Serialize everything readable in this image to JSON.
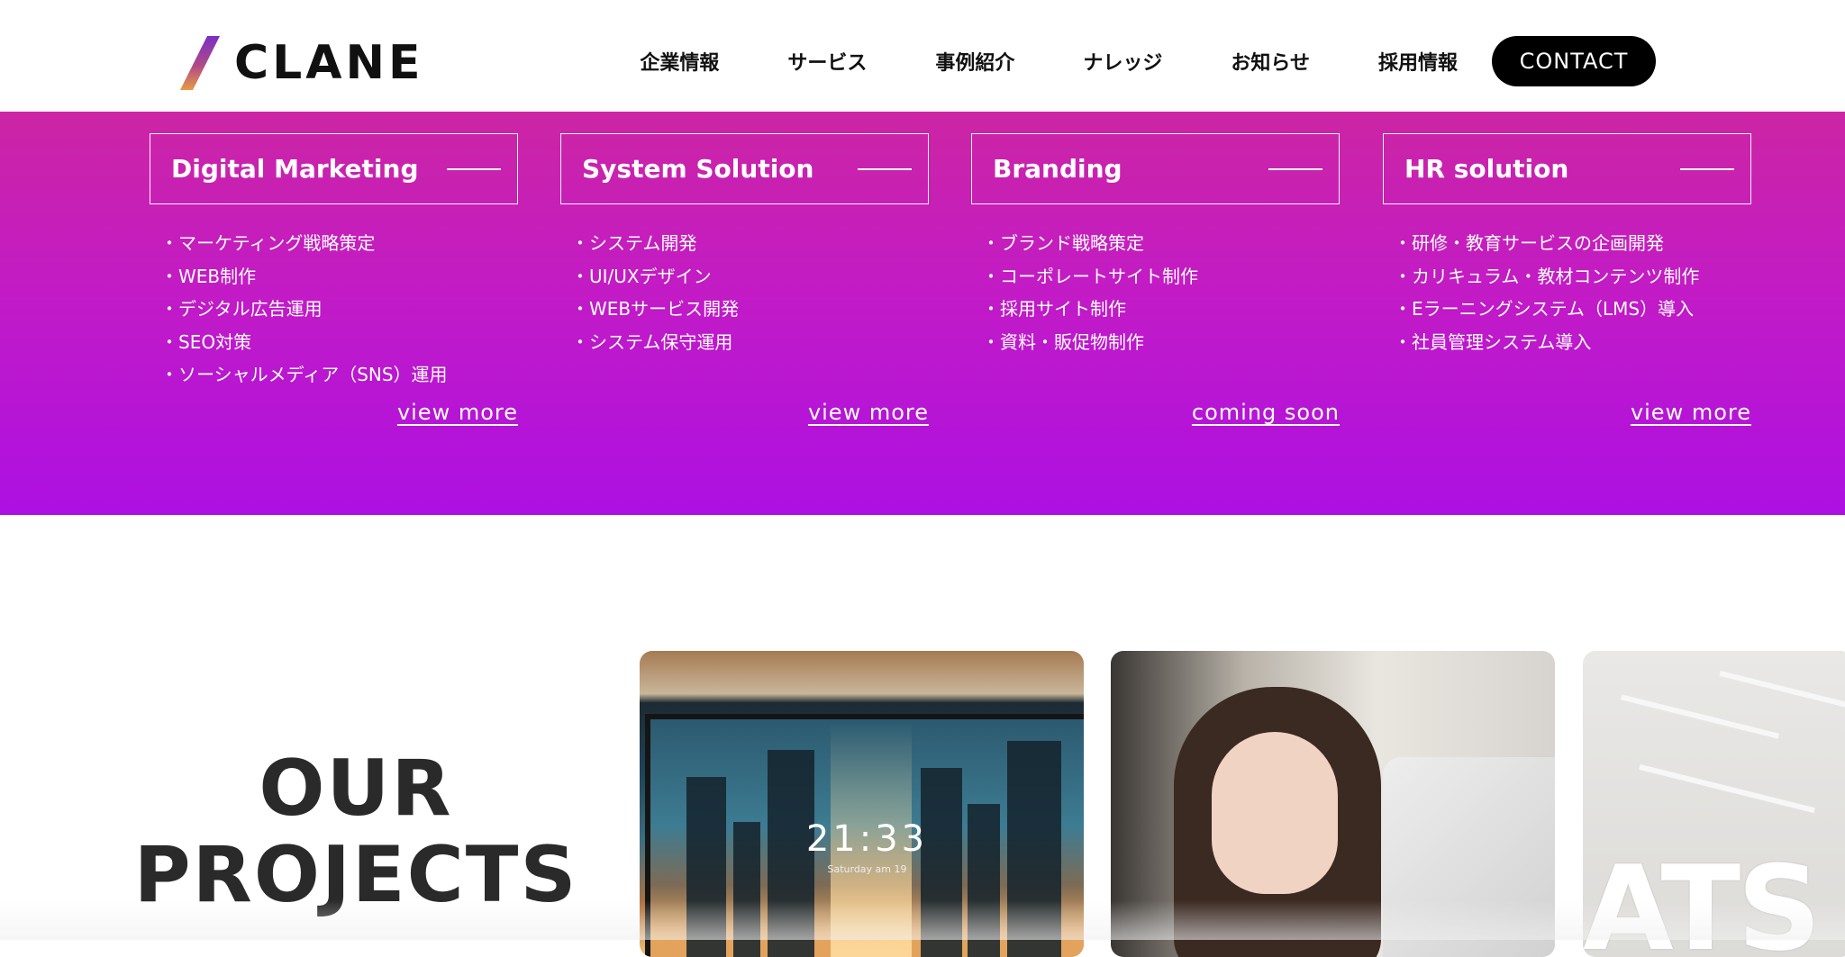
{
  "header": {
    "logo_text": "CLANE",
    "nav": [
      "企業情報",
      "サービス",
      "事例紹介",
      "ナレッジ",
      "お知らせ",
      "採用情報"
    ],
    "contact_label": "CONTACT"
  },
  "mega_menu": {
    "columns": [
      {
        "title": "Digital Marketing",
        "items": [
          "マーケティング戦略策定",
          "WEB制作",
          "デジタル広告運用",
          "SEO対策",
          "ソーシャルメディア（SNS）運用"
        ],
        "link": "view more"
      },
      {
        "title": "System Solution",
        "items": [
          "システム開発",
          "UI/UXデザイン",
          "WEBサービス開発",
          "システム保守運用"
        ],
        "link": "view more"
      },
      {
        "title": "Branding",
        "items": [
          "ブランド戦略策定",
          "コーポレートサイト制作",
          "採用サイト制作",
          "資料・販促物制作"
        ],
        "link": "coming soon"
      },
      {
        "title": "HR solution",
        "items": [
          "研修・教育サービスの企画開発",
          "カリキュラム・教材コンテンツ制作",
          "Eラーニングシステム（LMS）導入",
          "社員管理システム導入"
        ],
        "link": "view more"
      }
    ]
  },
  "projects": {
    "title_line1": "OUR",
    "title_line2": "PROJECTS",
    "card1_clock": "21:33",
    "card1_date": "Saturday am 19",
    "card3_text": "ATS"
  },
  "colors": {
    "gradient_top": "#cc25a4",
    "gradient_bottom": "#ad10e2",
    "contact_bg": "#000000"
  }
}
